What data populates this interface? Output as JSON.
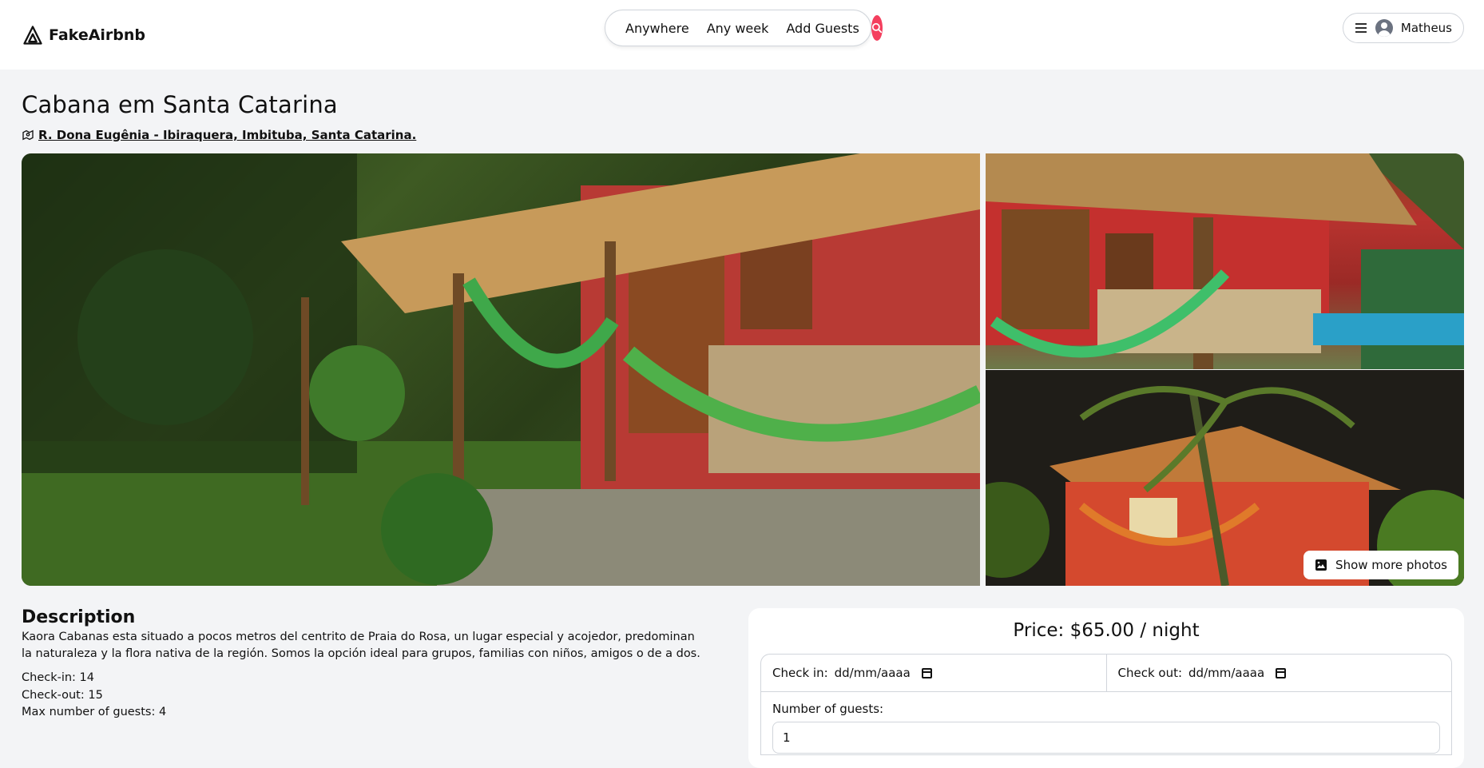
{
  "header": {
    "logo_text": "FakeAirbnb",
    "search": {
      "anywhere": "Anywhere",
      "any_week": "Any week",
      "add_guests": "Add Guests"
    },
    "user_name": "Matheus"
  },
  "listing": {
    "title": "Cabana em Santa Catarina",
    "address": "R. Dona Eugênia - Ibiraquera, Imbituba, Santa Catarina.",
    "show_more_photos": "Show more photos"
  },
  "description": {
    "heading": "Description",
    "text": "Kaora Cabanas esta situado a pocos metros del centrito de Praia do Rosa, un lugar especial y acojedor, predominan la naturaleza y la flora nativa de la región. Somos la opción ideal para grupos, familias con niños, amigos o de a dos.",
    "check_in": "Check-in: 14",
    "check_out": "Check-out: 15",
    "max_guests": "Max number of guests: 4"
  },
  "booking": {
    "price": "Price: $65.00 / night",
    "check_in_label": "Check in:",
    "check_in_placeholder": "dd/mm/aaaa",
    "check_out_label": "Check out:",
    "check_out_placeholder": "dd/mm/aaaa",
    "guests_label": "Number of guests:",
    "guests_value": "1"
  },
  "colors": {
    "accent": "#f43f5e",
    "page_bg": "#f3f4f6"
  }
}
